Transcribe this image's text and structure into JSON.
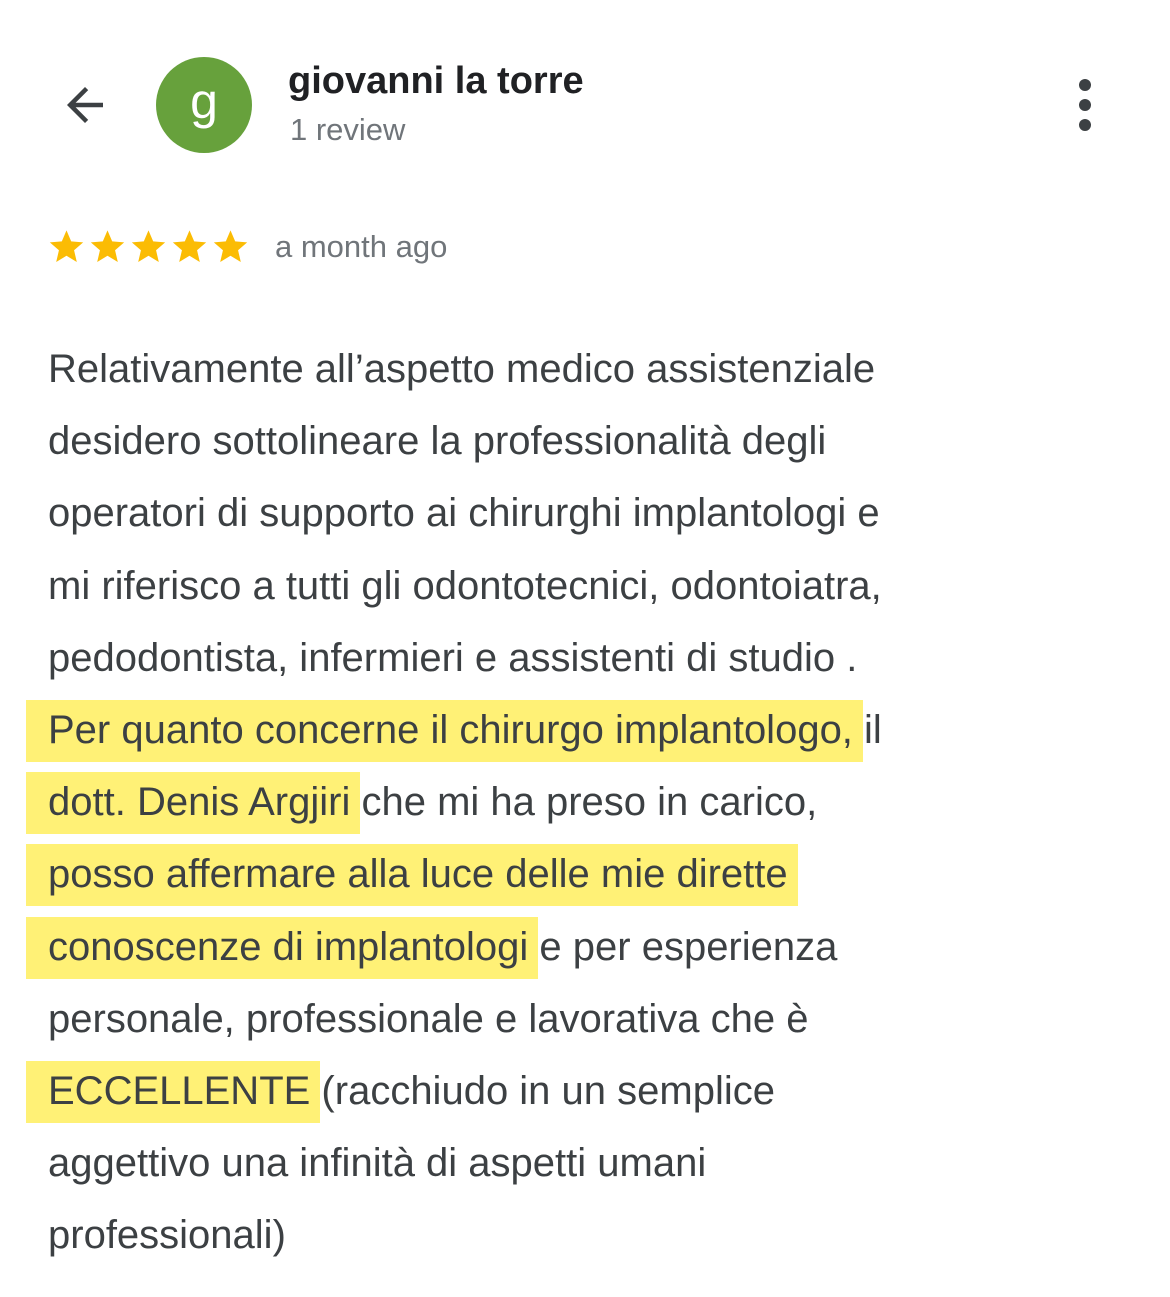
{
  "header": {
    "back_icon": "arrow-back-icon",
    "avatar_letter": "g",
    "avatar_color": "#67a13c",
    "reviewer_name": "giovanni la torre",
    "review_count": "1 review",
    "more_icon": "more-vert-icon"
  },
  "rating": {
    "stars": 5,
    "max_stars": 5,
    "star_color": "#fbbc04",
    "time_ago": "a month ago"
  },
  "review": {
    "highlight_color": "#fff176",
    "lines": [
      [
        {
          "text": "Relativamente all’aspetto medico assistenziale",
          "highlight": false
        }
      ],
      [
        {
          "text": "desidero sottolineare la professionalità degli",
          "highlight": false
        }
      ],
      [
        {
          "text": "operatori di supporto ai chirurghi implantologi e",
          "highlight": false
        }
      ],
      [
        {
          "text": "mi riferisco a tutti gli odontotecnici, odontoiatra,",
          "highlight": false
        }
      ],
      [
        {
          "text": "pedodontista, infermieri e assistenti di studio .",
          "highlight": false
        }
      ],
      [
        {
          "text": "Per quanto concerne il chirurgo implantologo,",
          "highlight": true
        },
        {
          "text": " il",
          "highlight": false
        }
      ],
      [
        {
          "text": "dott. Denis Argjiri",
          "highlight": true
        },
        {
          "text": " che mi ha preso in carico,",
          "highlight": false
        }
      ],
      [
        {
          "text": "posso affermare alla luce delle mie dirette",
          "highlight": true
        }
      ],
      [
        {
          "text": "conoscenze di implantologi",
          "highlight": true
        },
        {
          "text": " e per esperienza",
          "highlight": false
        }
      ],
      [
        {
          "text": "personale, professionale e lavorativa che è",
          "highlight": false
        }
      ],
      [
        {
          "text": "ECCELLENTE",
          "highlight": true
        },
        {
          "text": " (racchiudo in un semplice",
          "highlight": false
        }
      ],
      [
        {
          "text": "aggettivo una infinità di aspetti umani",
          "highlight": false
        }
      ],
      [
        {
          "text": "professionali)",
          "highlight": false
        }
      ]
    ]
  }
}
